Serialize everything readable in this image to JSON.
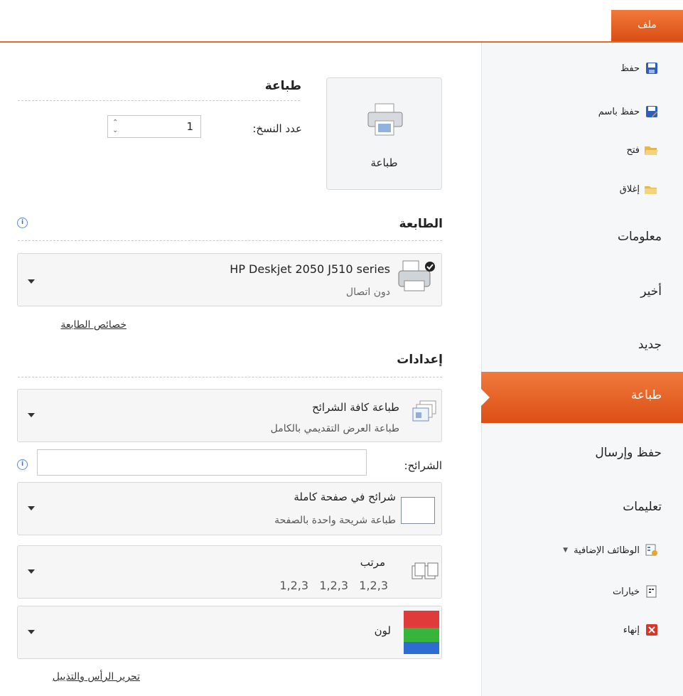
{
  "file_tab": "ملف",
  "nav": {
    "save": "حفظ",
    "save_as": "حفظ باسم",
    "open": "فتح",
    "close": "إغلاق",
    "info": "معلومات",
    "recent": "أخير",
    "new": "جديد",
    "print": "طباعة",
    "save_send": "حفظ وإرسال",
    "help": "تعليمات",
    "addins": "الوظائف الإضافية",
    "options": "خيارات",
    "exit": "إنهاء"
  },
  "print": {
    "title": "طباعة",
    "button_label": "طباعة",
    "copies_label": "عدد النسخ:",
    "copies_value": "1"
  },
  "printer": {
    "title": "الطابعة",
    "name": "HP Deskjet 2050 J510 series",
    "status": "دون اتصال",
    "properties_link": "خصائص الطابعة"
  },
  "settings": {
    "title": "إعدادات",
    "slides_range_main": "طباعة كافة الشرائح",
    "slides_range_sub": "طباعة العرض التقديمي بالكامل",
    "slides_label": "الشرائح:",
    "slides_value": "",
    "layout_main": "شرائح في صفحة كاملة",
    "layout_sub": "طباعة شريحة واحدة بالصفحة",
    "collate_main": "مرتب",
    "collate_sub": "1,2,3   1,2,3   1,2,3",
    "color_main": "لون",
    "header_footer_link": "تحرير الرأس والتذييل"
  }
}
